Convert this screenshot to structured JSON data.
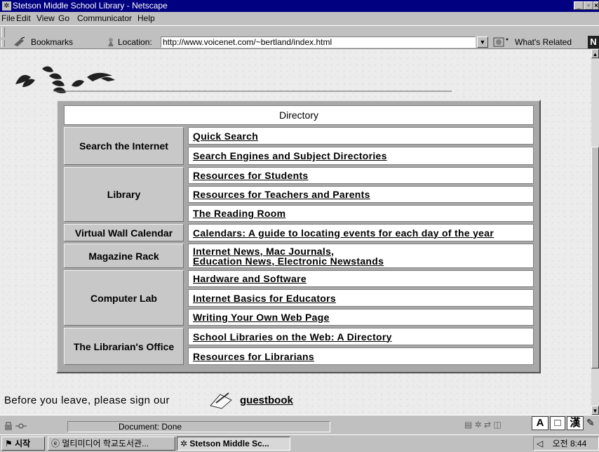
{
  "window": {
    "title": "Stetson Middle School Library - Netscape"
  },
  "menu": [
    "File",
    "Edit",
    "View",
    "Go",
    "Communicator",
    "Help"
  ],
  "toolbar": {
    "bookmarks_label": "Bookmarks",
    "location_label": "Location:",
    "url": "http://www.voicenet.com/~bertland/index.html",
    "whats_related": "What's Related"
  },
  "directory": {
    "heading": "Directory",
    "sections": [
      {
        "category": "Search the Internet",
        "links": [
          "Quick Search",
          "Search Engines and Subject Directories"
        ]
      },
      {
        "category": "Library",
        "links": [
          "Resources for Students",
          "Resources for Teachers and Parents",
          "The Reading Room"
        ]
      },
      {
        "category": "Virtual Wall Calendar",
        "links": [
          "Calendars: A guide to locating events for each day of the year"
        ]
      },
      {
        "category": "Magazine Rack",
        "links": [
          "Internet News, Mac Journals,\nEducation News, Electronic Newstands"
        ]
      },
      {
        "category": "Computer Lab",
        "links": [
          "Hardware and Software",
          "Internet Basics for Educators",
          "Writing Your Own Web Page"
        ]
      },
      {
        "category": "The Librarian's Office",
        "links": [
          "School Libraries on the Web: A Directory",
          "Resources for Librarians"
        ]
      }
    ]
  },
  "footer": {
    "text": "Before you leave, please sign our",
    "link": "guestbook"
  },
  "status": {
    "text": "Document: Done"
  },
  "ime": {
    "mode_a": "A",
    "mode_box": "□",
    "mode_han": "漢"
  },
  "taskbar": {
    "start_label": "시작",
    "items": [
      "멀티미디어 학교도서관...",
      "Stetson Middle Sc..."
    ],
    "clock": "오전 8:44"
  }
}
